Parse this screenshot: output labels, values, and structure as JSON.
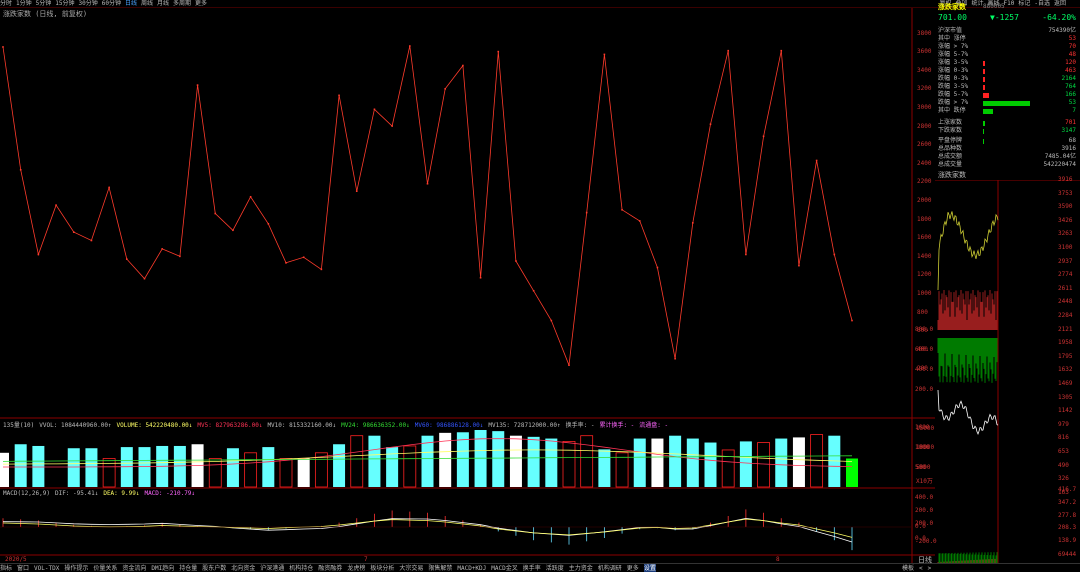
{
  "toolbar": {
    "periods": [
      "分时",
      "1分钟",
      "5分钟",
      "15分钟",
      "30分钟",
      "60分钟",
      "日线",
      "周线",
      "月线",
      "多周期",
      "更多"
    ],
    "active": "日线",
    "right": [
      "复权",
      "叠加",
      "统计",
      "画线",
      "F10",
      "标记",
      "-自选",
      "返回"
    ]
  },
  "chart": {
    "title": "涨跌家数 (日线, 前复权)",
    "axis": [
      "3800",
      "3600",
      "3400",
      "3200",
      "3000",
      "2800",
      "2600",
      "2400",
      "2200",
      "2000",
      "1800",
      "1600",
      "1400",
      "1200",
      "1000",
      "800",
      "600",
      "400",
      "200"
    ],
    "values": [
      3650,
      2330,
      1420,
      1950,
      1660,
      1570,
      2140,
      1370,
      1160,
      1480,
      1400,
      3240,
      1860,
      1680,
      2040,
      1750,
      1330,
      1390,
      1260,
      3130,
      2100,
      2980,
      2800,
      3660,
      2180,
      3200,
      3450,
      1170,
      3600,
      1350,
      1030,
      710,
      230,
      1870,
      3570,
      1900,
      1780,
      1280,
      300,
      1760,
      2820,
      3610,
      1420,
      2690,
      3610,
      1300,
      2430,
      1420,
      710
    ],
    "date_labels": [
      "2020/5",
      "7",
      "8"
    ]
  },
  "vol_legend": {
    "l0": "135量(10)",
    "l1": "VVOL: 1084440960.00↑",
    "l2": "VOLUME: 542220480.00↓",
    "l3": "MV5: 827963286.00↓",
    "l4": "MV10: 815332160.00↓",
    "l5": "MV24: 986636352.00↓",
    "l6": "MV60: 986886128.00↓",
    "l7": "MV135: 728712000.00↑",
    "l8": "换手率: -",
    "l9": "累计换手: -",
    "l10": "流通盘: -"
  },
  "vol_axis": [
    "15000",
    "10000",
    "5000",
    "X10万"
  ],
  "vol_bars": [
    0.6,
    0.75,
    0.72,
    0.0,
    0.68,
    0.68,
    0.5,
    0.7,
    0.7,
    0.72,
    0.72,
    0.75,
    0.5,
    0.68,
    0.6,
    0.7,
    0.5,
    0.5,
    0.6,
    0.75,
    0.9,
    0.9,
    0.7,
    0.72,
    0.9,
    0.95,
    0.96,
    1.0,
    0.98,
    0.9,
    0.88,
    0.85,
    0.8,
    0.9,
    0.66,
    0.6,
    0.85,
    0.85,
    0.9,
    0.85,
    0.78,
    0.65,
    0.8,
    0.78,
    0.85,
    0.87,
    0.92,
    0.9,
    0.5
  ],
  "vol_colors": [
    "w",
    "c",
    "c",
    "r",
    "c",
    "c",
    "r",
    "c",
    "c",
    "c",
    "c",
    "w",
    "r",
    "c",
    "r",
    "c",
    "r",
    "w",
    "r",
    "c",
    "r",
    "c",
    "c",
    "r",
    "c",
    "w",
    "c",
    "c",
    "c",
    "w",
    "c",
    "c",
    "r",
    "r",
    "c",
    "r",
    "c",
    "w",
    "c",
    "c",
    "c",
    "r",
    "c",
    "r",
    "c",
    "w",
    "r",
    "c",
    "g"
  ],
  "macd_legend": {
    "l0": "MACD(12,26,9)",
    "l1": "DIF: -95.41↓",
    "l2": "DEA: 9.99↓",
    "l3": "MACD: -210.79↓"
  },
  "macd_axis": [
    "400.0",
    "200.0",
    "0.0",
    "-200.0"
  ],
  "macd": [
    80,
    70,
    60,
    40,
    20,
    10,
    5,
    8,
    15,
    30,
    20,
    10,
    5,
    -10,
    -20,
    -30,
    -15,
    0,
    10,
    40,
    80,
    120,
    150,
    140,
    130,
    100,
    60,
    20,
    -40,
    -80,
    -120,
    -140,
    -160,
    -130,
    -100,
    -60,
    -20,
    -10,
    -30,
    -20,
    40,
    100,
    160,
    130,
    80,
    40,
    -40,
    -120,
    -210
  ],
  "right_panel": {
    "title": "涨跌家数",
    "code": "880005",
    "price": "701.00",
    "change": "▼-1257",
    "pct": "-64.20%",
    "rows": [
      {
        "k": "沪深市值",
        "v": "754390亿"
      },
      {
        "k": "其中 涨停",
        "v": "53"
      },
      {
        "k": "涨幅 > 7%",
        "v": "70"
      },
      {
        "k": "涨幅 5-7%",
        "v": "48"
      },
      {
        "k": "涨幅 3-5%",
        "v": "120"
      },
      {
        "k": "涨幅 0-3%",
        "v": "463"
      },
      {
        "k": "跌幅 0-3%",
        "v": "2164"
      },
      {
        "k": "跌幅 3-5%",
        "v": "764"
      },
      {
        "k": "跌幅 5-7%",
        "v": "166"
      },
      {
        "k": "跌幅 > 7%",
        "v": "53"
      },
      {
        "k": "其中 跌停",
        "v": "7"
      },
      {
        "k": "上涨家数",
        "v": "701"
      },
      {
        "k": "下跌家数",
        "v": "3147"
      },
      {
        "k": "平盘停牌",
        "v": "68"
      },
      {
        "k": "总品种数",
        "v": "3916"
      },
      {
        "k": "总成交额",
        "v": "7485.04亿"
      },
      {
        "k": "总成交量",
        "v": "542220474"
      }
    ],
    "mini_title": "涨跌家数",
    "mini_axis": [
      "3916",
      "3753",
      "3590",
      "3426",
      "3263",
      "3100",
      "2937",
      "2774",
      "2611",
      "2448",
      "2284",
      "2121",
      "1958",
      "1795",
      "1632",
      "1469",
      "1305",
      "1142",
      "979",
      "816",
      "653",
      "490",
      "326",
      "163"
    ],
    "left_axis": [
      "800.0",
      "600.0",
      "400.0",
      "200.0",
      "1600",
      "1000",
      "500"
    ],
    "vol_axis": [
      "416.7",
      "347.2",
      "277.8",
      "208.3",
      "138.9",
      "69444"
    ],
    "mini_bot": "日线",
    "mini_left_bot": [
      "200.0",
      "0.0"
    ]
  },
  "bottom_tabs": [
    "指标",
    "窗口",
    "VOL-TDX",
    "操作提示",
    "价量关系",
    "资金流向",
    "DMI趋向",
    "持仓量",
    "股东户数",
    "北向资金",
    "沪深港通",
    "机构持仓",
    "融资融券",
    "龙虎榜",
    "板块分析",
    "大宗交易",
    "限售解禁",
    "MACD+KDJ",
    "MACD金叉",
    "换手率",
    "活跃度",
    "主力资金",
    "机构调研",
    "更多",
    "设置"
  ],
  "bottom_right": [
    "模板",
    "<",
    ">"
  ]
}
